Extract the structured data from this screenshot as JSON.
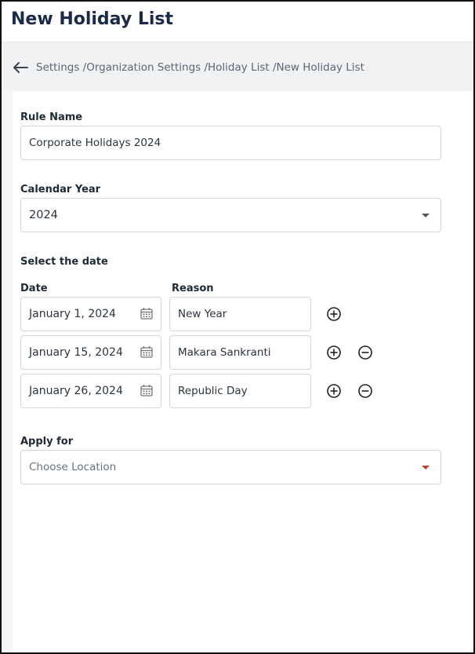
{
  "page": {
    "title": "New Holiday List"
  },
  "breadcrumb": {
    "text": "Settings /Organization Settings /Holiday List /New Holiday List"
  },
  "form": {
    "rule_name": {
      "label": "Rule Name",
      "value": "Corporate Holidays 2024"
    },
    "calendar_year": {
      "label": "Calendar Year",
      "value": "2024"
    },
    "section_label": "Select the date",
    "date_header": "Date",
    "reason_header": "Reason",
    "rows": [
      {
        "date": "January 1, 2024",
        "reason": "New Year"
      },
      {
        "date": "January 15, 2024",
        "reason": "Makara Sankranti"
      },
      {
        "date": "January 26, 2024",
        "reason": "Republic Day"
      }
    ],
    "apply_for": {
      "label": "Apply for",
      "placeholder": "Choose Location"
    }
  },
  "colors": {
    "title": "#1b2a4a",
    "accent_arrow": "#c0442b"
  }
}
